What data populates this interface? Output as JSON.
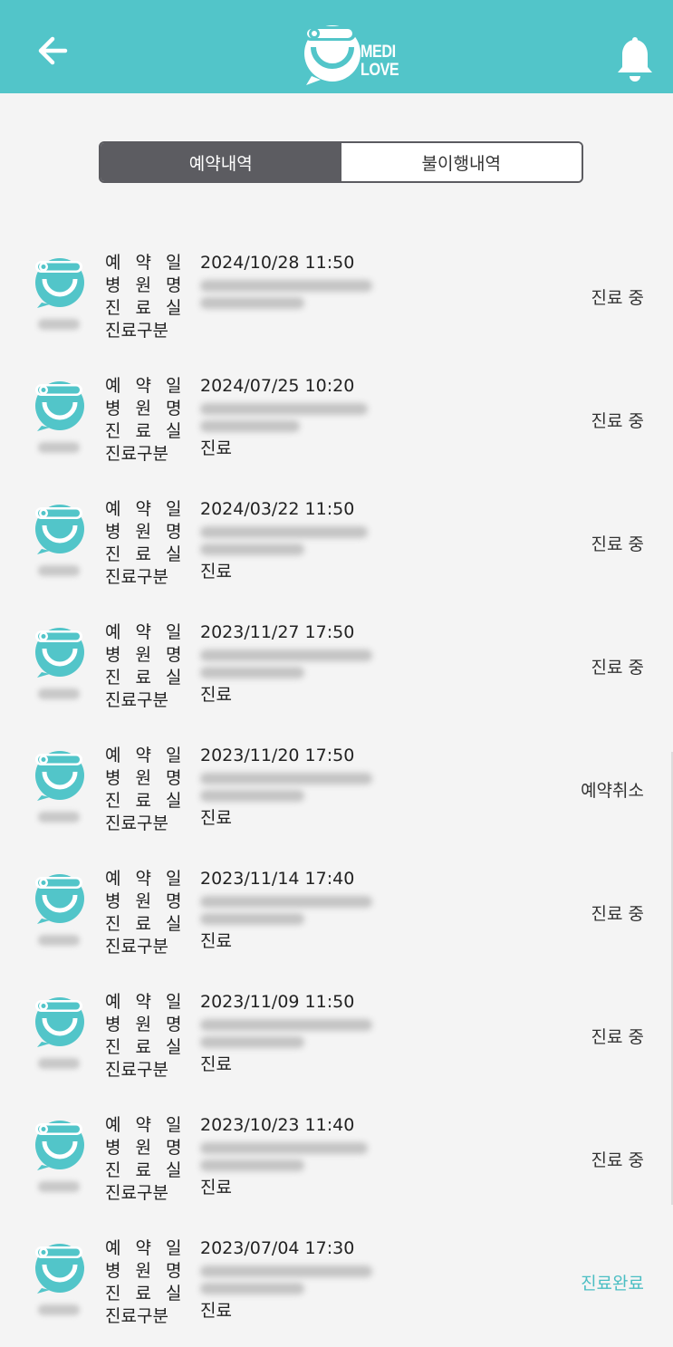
{
  "header": {
    "logo_line1": "MEDI",
    "logo_line2": "LOVE",
    "back_icon": "arrow-left-icon",
    "bell_icon": "bell-icon",
    "bg_color": "#52c5c9"
  },
  "tabs": [
    {
      "label": "예약내역",
      "active": true
    },
    {
      "label": "불이행내역",
      "active": false
    }
  ],
  "field_labels": {
    "date": "예 약 일",
    "hospital": "병 원 명",
    "room": "진 료 실",
    "type": "진료구분"
  },
  "reservations": [
    {
      "date": "2024/10/28 11:50",
      "type": "",
      "status": "진료 중"
    },
    {
      "date": "2024/07/25 10:20",
      "type": "진료",
      "status": "진료 중"
    },
    {
      "date": "2024/03/22 11:50",
      "type": "진료",
      "status": "진료 중"
    },
    {
      "date": "2023/11/27 17:50",
      "type": "진료",
      "status": "진료 중"
    },
    {
      "date": "2023/11/20 17:50",
      "type": "진료",
      "status": "예약취소"
    },
    {
      "date": "2023/11/14 17:40",
      "type": "진료",
      "status": "진료 중"
    },
    {
      "date": "2023/11/09 11:50",
      "type": "진료",
      "status": "진료 중"
    },
    {
      "date": "2023/10/23 11:40",
      "type": "진료",
      "status": "진료 중"
    },
    {
      "date": "2023/07/04 17:30",
      "type": "진료",
      "status": "진료완료"
    }
  ],
  "colors": {
    "accent": "#52c5c9",
    "status_done": "#4bbec3",
    "tab_active_bg": "#5c5c61"
  }
}
